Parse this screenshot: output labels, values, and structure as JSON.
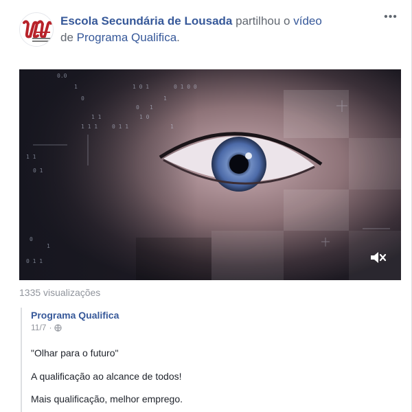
{
  "post": {
    "page_name": "Escola Secundária de Lousada",
    "action_text": "partilhou o",
    "video_link": "vídeo",
    "from_text": "de",
    "source_page": "Programa Qualifica",
    "end_punct": ".",
    "avatar_icon": "school-logo-icon",
    "more_icon": "more-options-icon",
    "more_label": "•••"
  },
  "video": {
    "mute_icon": "speaker-muted-icon",
    "views": "1335 visualizações"
  },
  "shared": {
    "author": "Programa Qualifica",
    "date": "11/7",
    "separator": "·",
    "privacy_icon": "globe-icon",
    "messages": [
      "\"Olhar para o futuro\"",
      "A qualificação ao alcance de todos!",
      "Mais qualificação, melhor emprego."
    ]
  },
  "colors": {
    "link": "#365899",
    "meta": "#90949c",
    "text": "#1d2129",
    "logo": "#b8232a"
  }
}
